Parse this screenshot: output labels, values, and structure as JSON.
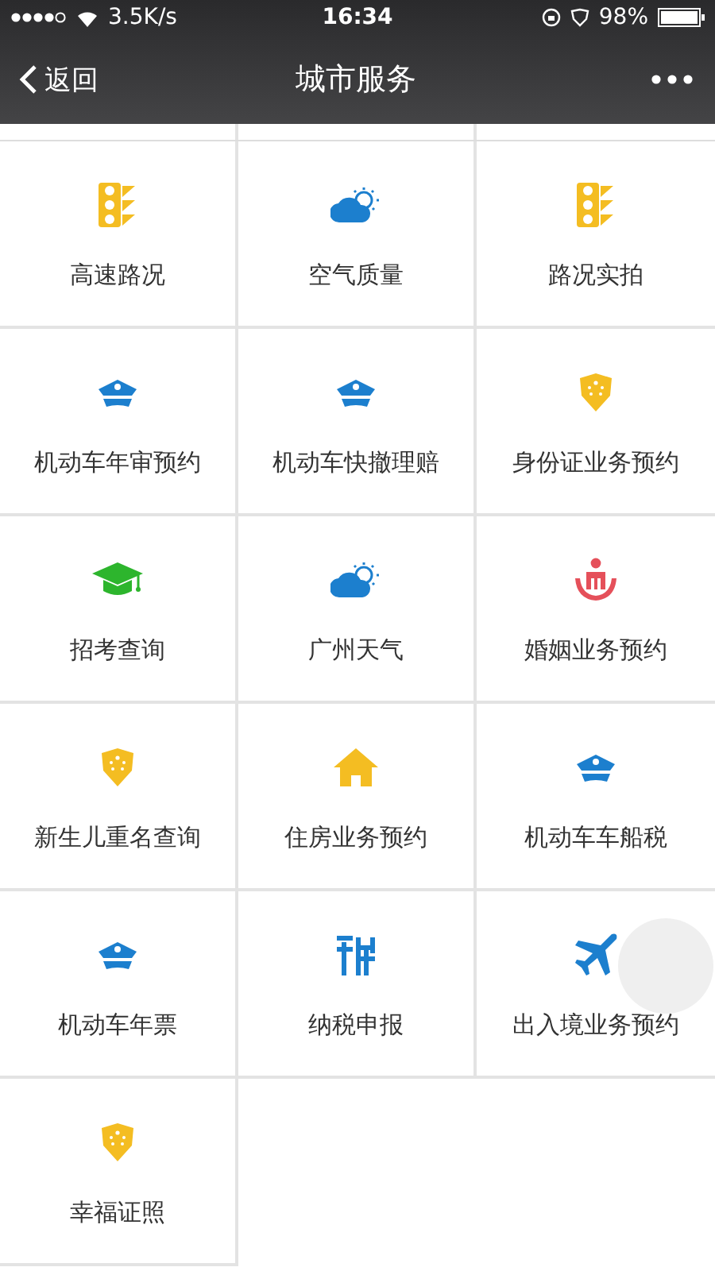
{
  "status_bar": {
    "network_speed": "3.5K/s",
    "time": "16:34",
    "battery": "98%"
  },
  "nav_bar": {
    "back_label": "返回",
    "title": "城市服务"
  },
  "services": [
    {
      "label": "高速路况",
      "kind": "traffic"
    },
    {
      "label": "空气质量",
      "kind": "weather"
    },
    {
      "label": "路况实拍",
      "kind": "traffic"
    },
    {
      "label": "机动车年审预约",
      "kind": "cap"
    },
    {
      "label": "机动车快撤理赔",
      "kind": "cap"
    },
    {
      "label": "身份证业务预约",
      "kind": "shield"
    },
    {
      "label": "招考查询",
      "kind": "graduation"
    },
    {
      "label": "广州天气",
      "kind": "weather"
    },
    {
      "label": "婚姻业务预约",
      "kind": "family"
    },
    {
      "label": "新生儿重名查询",
      "kind": "shield"
    },
    {
      "label": "住房业务预约",
      "kind": "house"
    },
    {
      "label": "机动车车船税",
      "kind": "cap"
    },
    {
      "label": "机动车年票",
      "kind": "cap"
    },
    {
      "label": "纳税申报",
      "kind": "tax"
    },
    {
      "label": "出入境业务预约",
      "kind": "plane"
    },
    {
      "label": "幸福证照",
      "kind": "shield"
    }
  ]
}
